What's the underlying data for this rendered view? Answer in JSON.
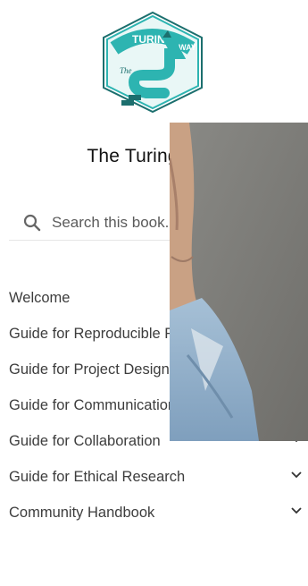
{
  "site": {
    "title": "The Turing Way"
  },
  "search": {
    "placeholder": "Search this book..."
  },
  "nav": {
    "items": [
      {
        "label": "Welcome",
        "expandable": false
      },
      {
        "label": "Guide for Reproducible Research",
        "expandable": true
      },
      {
        "label": "Guide for Project Design",
        "expandable": true
      },
      {
        "label": "Guide for Communication",
        "expandable": true
      },
      {
        "label": "Guide for Collaboration",
        "expandable": true
      },
      {
        "label": "Guide for Ethical Research",
        "expandable": true
      },
      {
        "label": "Community Handbook",
        "expandable": true
      }
    ]
  },
  "logo": {
    "text_line1": "TURING",
    "text_line2": "WAY",
    "text_prefix": "The"
  },
  "colors": {
    "brand": "#2db4b1",
    "brand_dark": "#1c6f6e",
    "text": "#3d3d3d"
  }
}
